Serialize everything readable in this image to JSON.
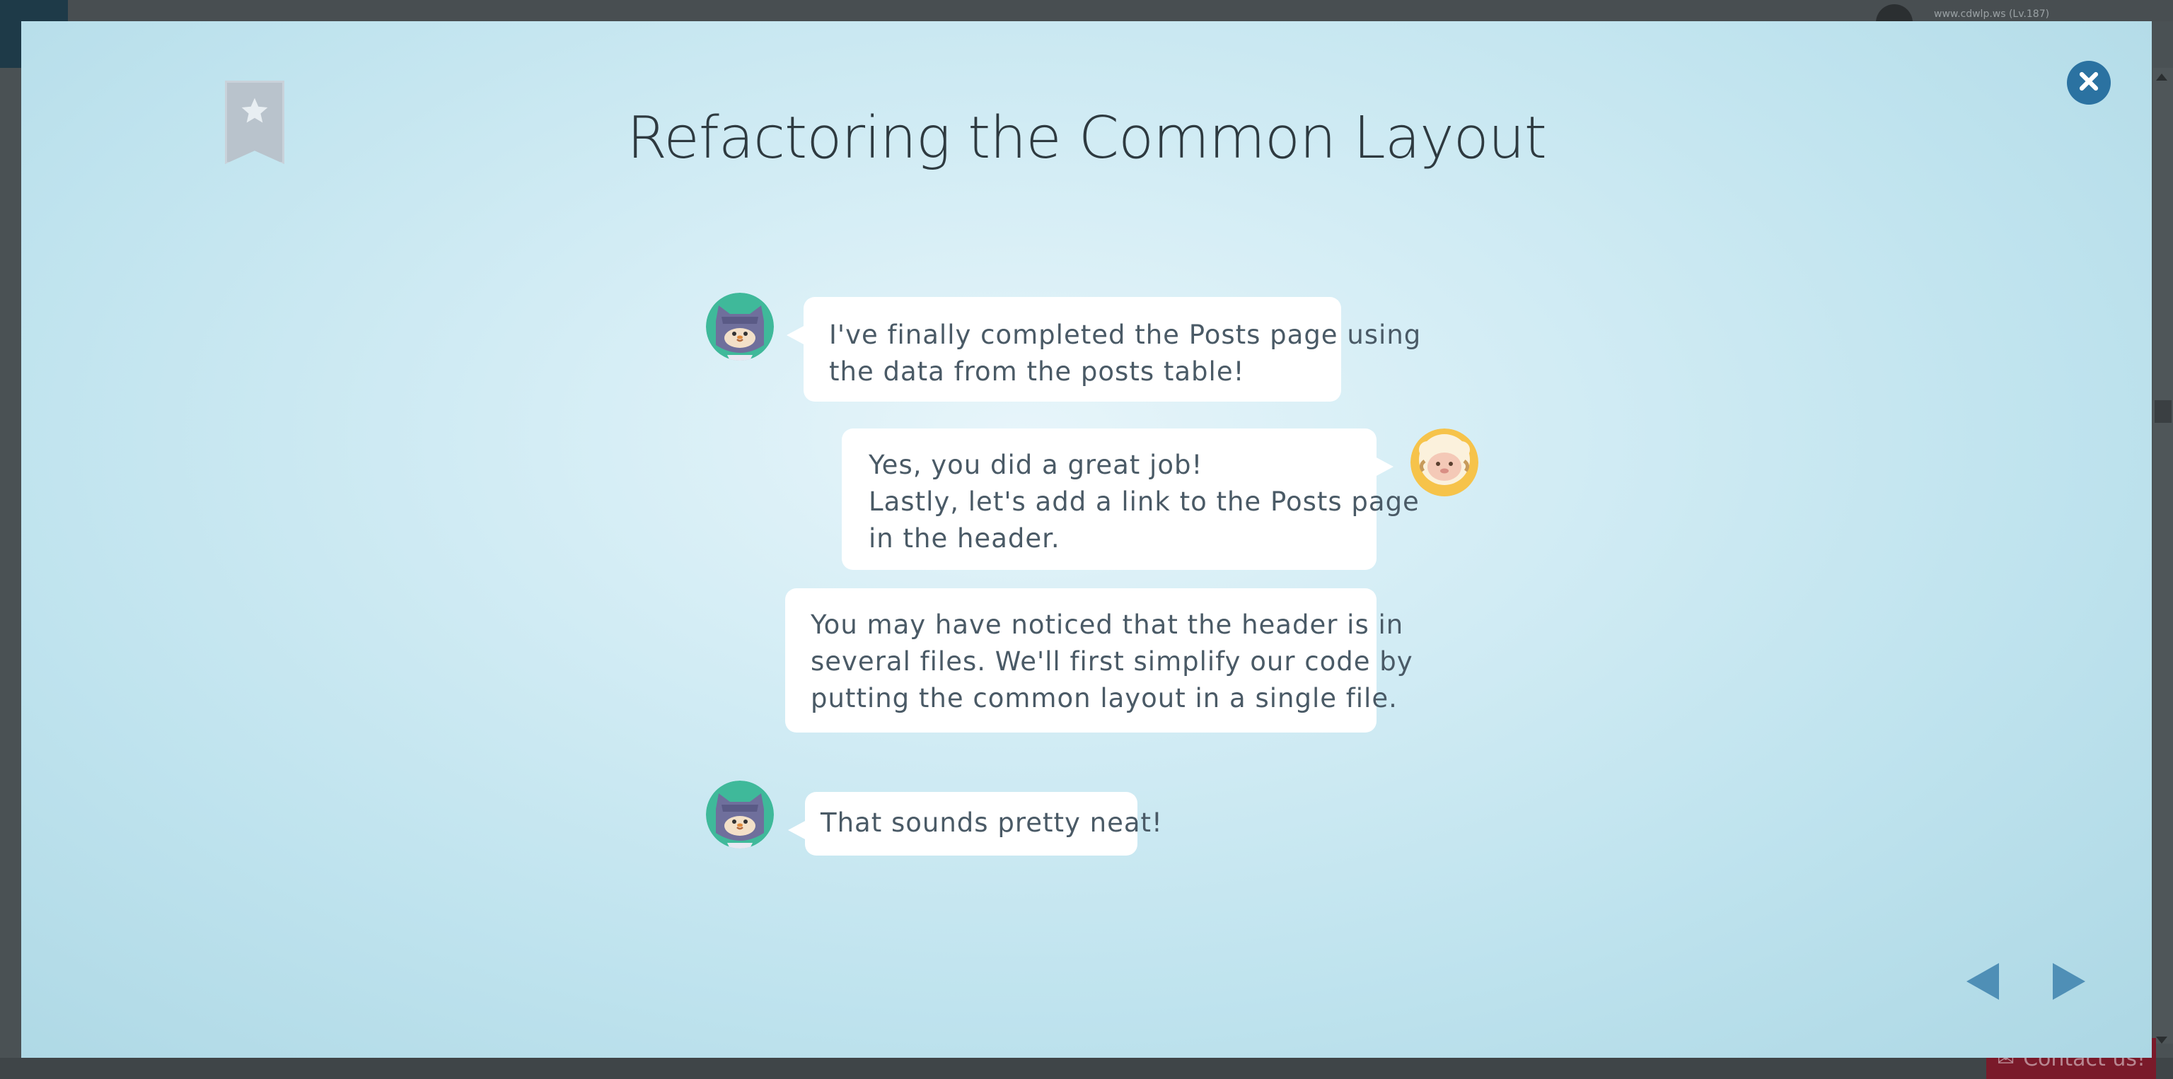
{
  "background": {
    "user_label": "www.cdwlp.ws (Lv.187)",
    "contact_label": "Contact us!"
  },
  "modal": {
    "title": "Refactoring the Common Layout",
    "bookmark_icon": "star-icon",
    "close_icon": "close-icon",
    "messages": [
      {
        "speaker": "ninja-cat",
        "side": "left",
        "lines": [
          "I've finally completed the Posts page using",
          "the data from the posts table!"
        ]
      },
      {
        "speaker": "sheep",
        "side": "right",
        "lines": [
          "Yes, you did a great job!",
          "Lastly, let's add a link to the Posts page",
          "in the header."
        ]
      },
      {
        "speaker": "sheep",
        "side": "right",
        "lines": [
          "You may have noticed that the header is in",
          "several files. We'll first simplify our code by",
          "putting the common layout in a single file."
        ]
      },
      {
        "speaker": "ninja-cat",
        "side": "left",
        "lines": [
          "That sounds pretty neat!"
        ]
      }
    ],
    "nav": {
      "prev_icon": "triangle-left-icon",
      "next_icon": "triangle-right-icon"
    }
  },
  "colors": {
    "close_button": "#2b72a1",
    "nav_arrows": "#4f8fb6",
    "bubble_text": "#4a5a66",
    "title_text": "#2e3a40",
    "cat_avatar_bg": "#3fb99a",
    "sheep_avatar_bg": "#f6c34a"
  }
}
